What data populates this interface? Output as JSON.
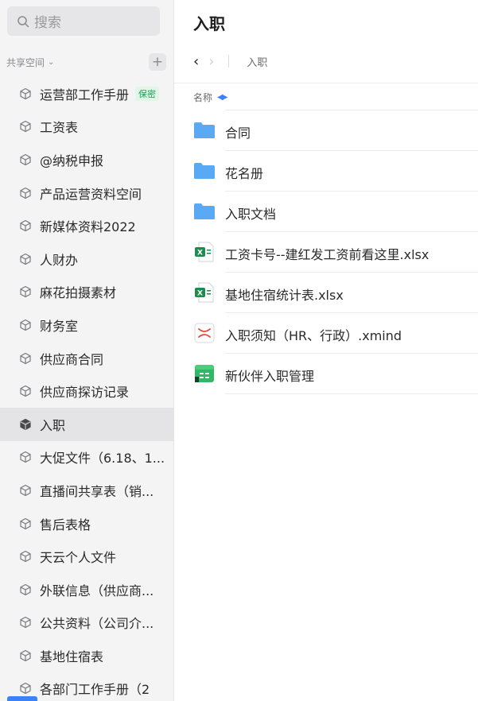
{
  "search": {
    "placeholder": "搜索"
  },
  "sidebar": {
    "section_label": "共享空间",
    "items": [
      {
        "label": "运营部工作手册",
        "badge": "保密"
      },
      {
        "label": "工资表"
      },
      {
        "label": "@纳税申报"
      },
      {
        "label": "产品运营资料空间"
      },
      {
        "label": "新媒体资料2022"
      },
      {
        "label": "人财办"
      },
      {
        "label": "麻花拍摄素材"
      },
      {
        "label": "财务室"
      },
      {
        "label": "供应商合同"
      },
      {
        "label": "供应商探访记录"
      },
      {
        "label": "入职",
        "active": true
      },
      {
        "label": "大促文件（6.18、1..."
      },
      {
        "label": "直播间共享表（销..."
      },
      {
        "label": "售后表格"
      },
      {
        "label": "天云个人文件"
      },
      {
        "label": "外联信息（供应商..."
      },
      {
        "label": "公共资料（公司介..."
      },
      {
        "label": "基地住宿表"
      },
      {
        "label": "各部门工作手册（2"
      }
    ]
  },
  "main": {
    "title": "入职",
    "breadcrumb": "入职",
    "column_name": "名称",
    "files": [
      {
        "name": "合同",
        "type": "folder"
      },
      {
        "name": "花名册",
        "type": "folder"
      },
      {
        "name": "入职文档",
        "type": "folder"
      },
      {
        "name": "工资卡号--建红发工资前看这里.xlsx",
        "type": "excel"
      },
      {
        "name": "基地住宿统计表.xlsx",
        "type": "excel"
      },
      {
        "name": "入职须知（HR、行政）.xmind",
        "type": "xmind"
      },
      {
        "name": "新伙伴入职管理",
        "type": "sheet-app"
      }
    ]
  },
  "colors": {
    "accent": "#3b82f6",
    "folder": "#5aa9f5",
    "excel": "#1e8a4c",
    "xmind": "#e0483e",
    "badge_text": "#1f9d55"
  }
}
